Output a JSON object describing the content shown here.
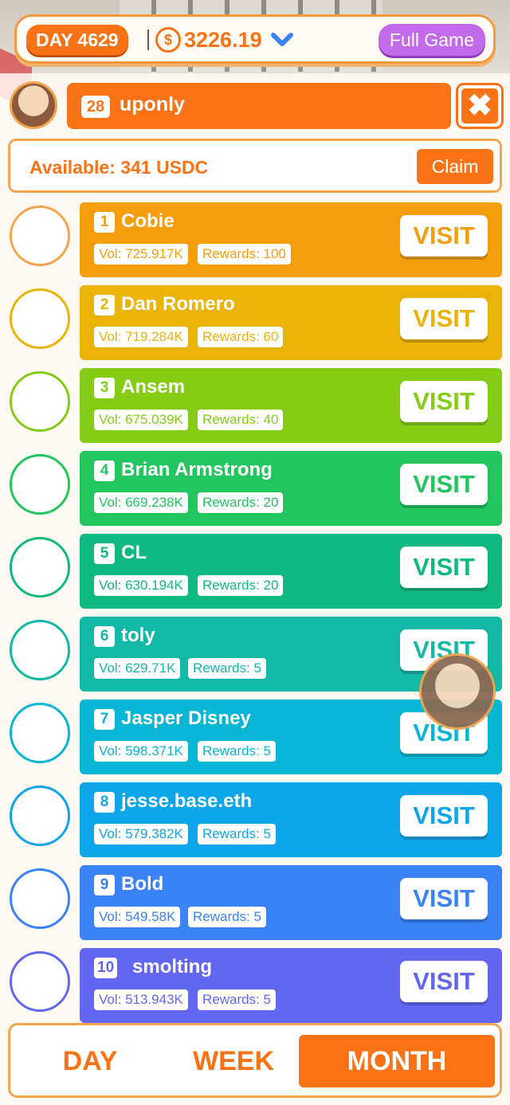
{
  "hud": {
    "day_label": "DAY 4629",
    "balance": "3226.19",
    "full_game_label": "Full Game"
  },
  "me": {
    "rank": "28",
    "name": "uponly",
    "close_glyph": "✖"
  },
  "available": {
    "text": "Available: 341 USDC",
    "claim_label": "Claim"
  },
  "leaderboard": [
    {
      "rank": "1",
      "name": "Cobie",
      "vol": "Vol: 725.917K",
      "rewards": "Rewards: 100",
      "visit": "VISIT",
      "color": "#f59e0b",
      "border": "#f3a54e"
    },
    {
      "rank": "2",
      "name": "Dan Romero",
      "vol": "Vol: 719.284K",
      "rewards": "Rewards: 60",
      "visit": "VISIT",
      "color": "#eab308",
      "border": "#eab308"
    },
    {
      "rank": "3",
      "name": "Ansem",
      "vol": "Vol: 675.039K",
      "rewards": "Rewards: 40",
      "visit": "VISIT",
      "color": "#84cc16",
      "border": "#84cc16"
    },
    {
      "rank": "4",
      "name": "Brian Armstrong",
      "vol": "Vol: 669.238K",
      "rewards": "Rewards: 20",
      "visit": "VISIT",
      "color": "#22c55e",
      "border": "#22c55e"
    },
    {
      "rank": "5",
      "name": "CL",
      "vol": "Vol: 630.194K",
      "rewards": "Rewards: 20",
      "visit": "VISIT",
      "color": "#10b981",
      "border": "#10b981"
    },
    {
      "rank": "6",
      "name": "toly",
      "vol": "Vol: 629.71K",
      "rewards": "Rewards: 5",
      "visit": "VISIT",
      "color": "#14b8a6",
      "border": "#14b8a6"
    },
    {
      "rank": "7",
      "name": "Jasper Disney",
      "vol": "Vol: 598.371K",
      "rewards": "Rewards: 5",
      "visit": "VISIT",
      "color": "#06b6d4",
      "border": "#06b6d4"
    },
    {
      "rank": "8",
      "name": "jesse.base.eth",
      "vol": "Vol: 579.382K",
      "rewards": "Rewards: 5",
      "visit": "VISIT",
      "color": "#0ea5e9",
      "border": "#0ea5e9"
    },
    {
      "rank": "9",
      "name": "Bold",
      "vol": "Vol: 549.58K",
      "rewards": "Rewards: 5",
      "visit": "VISIT",
      "color": "#3b82f6",
      "border": "#3b82f6"
    },
    {
      "rank": "10",
      "name": "smolting",
      "vol": "Vol: 513.943K",
      "rewards": "Rewards: 5",
      "visit": "VISIT",
      "color": "#6366f1",
      "border": "#6366f1"
    }
  ],
  "tabs": {
    "day": "DAY",
    "week": "WEEK",
    "month": "MONTH",
    "active": "month"
  },
  "icons": {
    "coin": "usdc-coin-icon",
    "chevron": "chevron-down-icon",
    "close": "close-icon"
  }
}
